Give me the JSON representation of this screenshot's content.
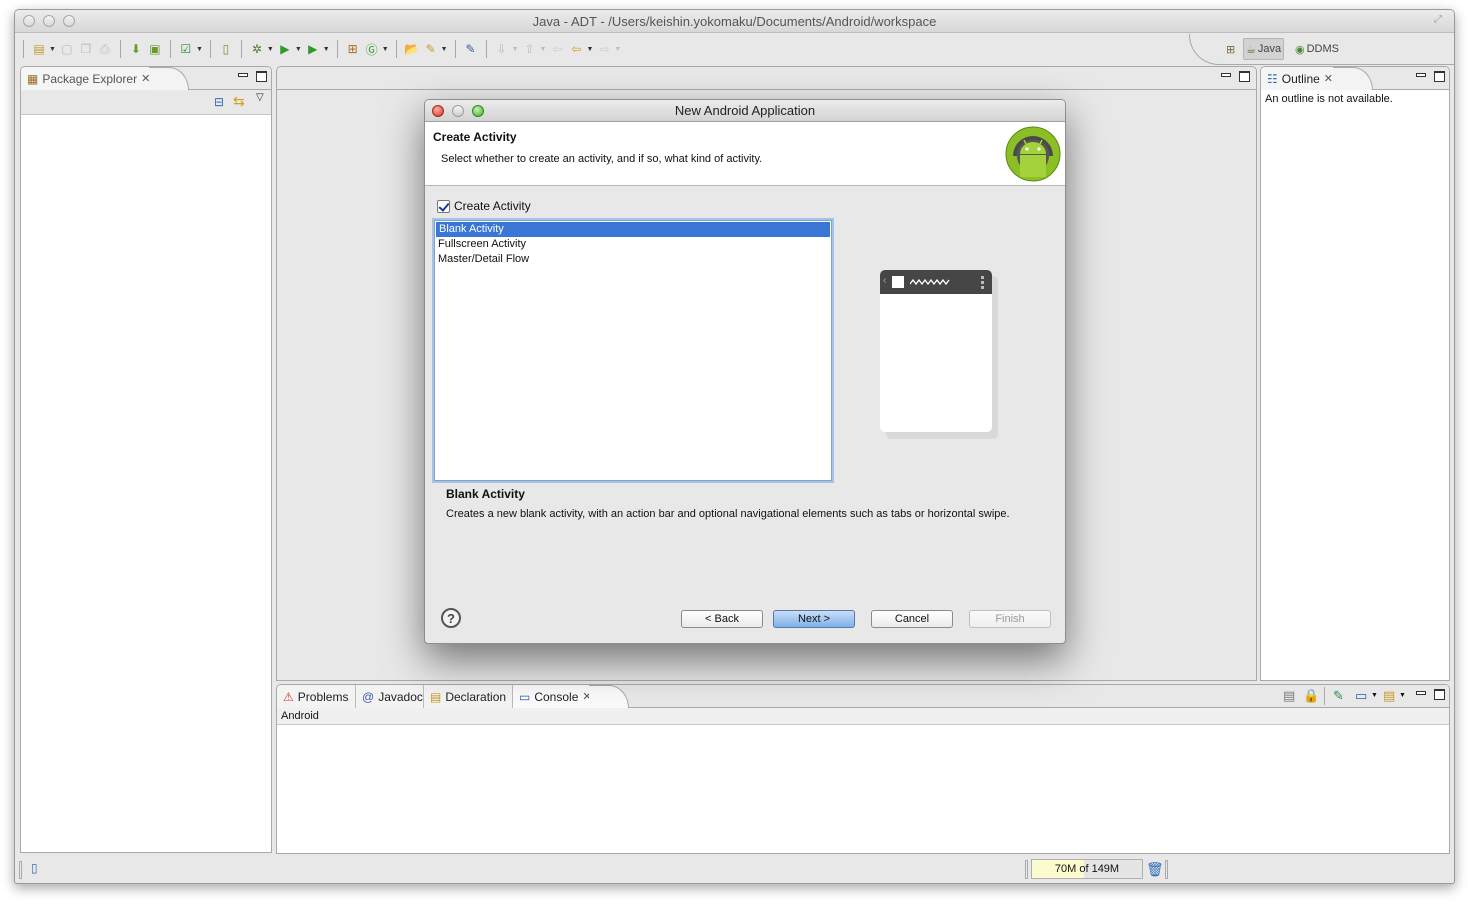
{
  "window": {
    "title": "Java - ADT - /Users/keishin.yokomaku/Documents/Android/workspace"
  },
  "toolbar": {
    "icons": [
      "new-wizard-icon",
      "save-icon",
      "save-all-icon",
      "print-icon",
      "android-sdk-manager-icon",
      "android-avd-manager-icon",
      "lint-check-icon",
      "new-android-xml-icon",
      "debug-icon",
      "run-icon",
      "external-tools-icon",
      "new-java-package-icon",
      "new-java-class-icon",
      "open-type-icon",
      "search-icon",
      "toggle-mark-occurrences-icon",
      "next-annotation-icon",
      "previous-annotation-icon",
      "last-edit-location-icon",
      "back-icon",
      "forward-icon"
    ]
  },
  "perspectives": {
    "open_perspective_icon": "open-perspective-icon",
    "items": [
      {
        "label": "Java",
        "active": true
      },
      {
        "label": "DDMS",
        "active": false
      }
    ]
  },
  "package_explorer": {
    "tab_label": "Package Explorer"
  },
  "outline": {
    "tab_label": "Outline",
    "message": "An outline is not available."
  },
  "bottom_panel": {
    "tabs": [
      {
        "label": "Problems",
        "active": false
      },
      {
        "label": "Javadoc",
        "active": false
      },
      {
        "label": "Declaration",
        "active": false
      },
      {
        "label": "Console",
        "active": true
      }
    ],
    "console_name": "Android"
  },
  "status_bar": {
    "heap_text": "70M of 149M",
    "heap_used_mb": 70,
    "heap_total_mb": 149
  },
  "dialog": {
    "title": "New Android Application",
    "banner_title": "Create Activity",
    "banner_description": "Select whether to create an activity, and if so, what kind of activity.",
    "create_activity_label": "Create Activity",
    "create_activity_checked": true,
    "activity_types": [
      {
        "label": "Blank Activity",
        "selected": true
      },
      {
        "label": "Fullscreen Activity",
        "selected": false
      },
      {
        "label": "Master/Detail Flow",
        "selected": false
      }
    ],
    "selected_title": "Blank Activity",
    "selected_description": "Creates a new blank activity, with an action bar and optional navigational elements such as tabs or horizontal swipe.",
    "buttons": {
      "help": "?",
      "back": "< Back",
      "next": "Next >",
      "cancel": "Cancel",
      "finish": "Finish"
    }
  }
}
